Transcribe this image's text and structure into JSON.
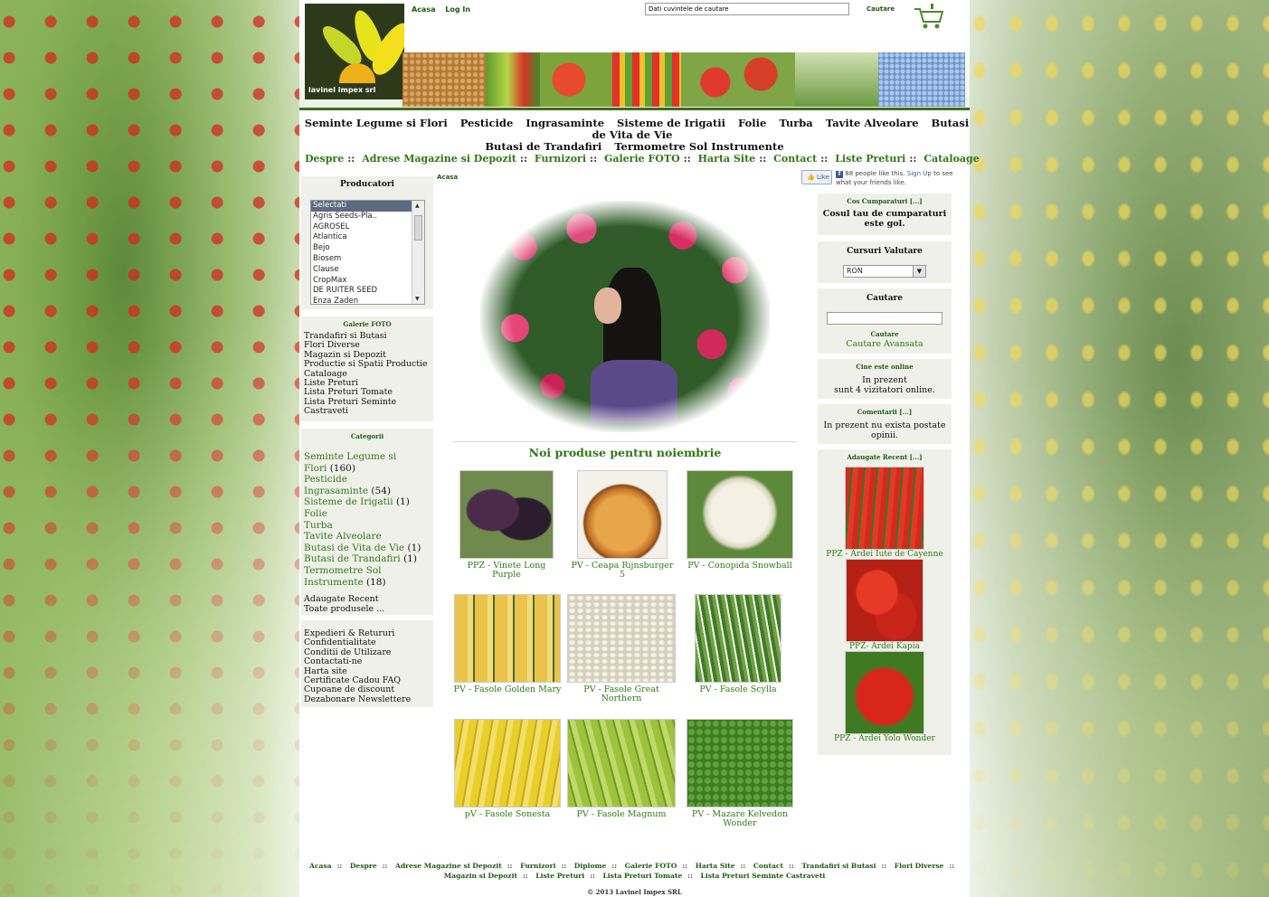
{
  "header": {
    "logo_text": "lavinel impex srl",
    "toplinks": [
      "Acasa",
      "Log In"
    ],
    "search_value": "Dati cuvintele de cautare",
    "search_button": "Cautare"
  },
  "nav_main": {
    "items": [
      "Seminte Legume si Flori",
      "Pesticide",
      "Ingrasaminte",
      "Sisteme de Irigatii",
      "Folie",
      "Turba",
      "Tavite Alveolare",
      "Butasi de Vita de Vie",
      "Butasi de Trandafiri",
      "Termometre Sol Instrumente"
    ]
  },
  "nav_secondary": {
    "items": [
      "Despre",
      "Adrese Magazine si Depozit",
      "Furnizori",
      "Galerie FOTO",
      "Harta Site",
      "Contact",
      "Liste Preturi",
      "Cataloage"
    ],
    "separator": "::"
  },
  "breadcrumb": "Acasa",
  "facebook": {
    "like_label": "Like",
    "text_prefix": "88 people like this.",
    "signup": "Sign Up",
    "text_suffix": "to see what your friends like."
  },
  "producatori": {
    "title": "Producatori",
    "options": [
      "Selectati",
      "Agris Seeds-Pla..",
      "AGROSEL",
      "Atlantica",
      "Bejo",
      "Biosem",
      "Clause",
      "CropMax",
      "DE RUITER SEED",
      "Enza Zaden"
    ]
  },
  "galerie": {
    "title": "Galerie FOTO",
    "items": [
      "Trandafiri si Butasi",
      "Flori Diverse",
      "Magazin si Depozit",
      "Productie si Spatii Productie",
      "Cataloage",
      "Liste Preturi",
      "Lista Preturi Tomate",
      "Lista Preturi Seminte",
      "Castraveti"
    ]
  },
  "categorii": {
    "title": "Categorii",
    "items": [
      {
        "name": "Seminte Legume si",
        "count": ""
      },
      {
        "name": "Flori",
        "count": "(160)"
      },
      {
        "name": "Pesticide",
        "count": ""
      },
      {
        "name": "Ingrasaminte",
        "count": "(54)"
      },
      {
        "name": "Sisteme de Irigatii",
        "count": "(1)"
      },
      {
        "name": "Folie",
        "count": ""
      },
      {
        "name": "Turba",
        "count": ""
      },
      {
        "name": "Tavite Alveolare",
        "count": ""
      },
      {
        "name": "Butasi de Vita de Vie",
        "count": "(1)"
      },
      {
        "name": "Butasi de Trandafiri",
        "count": "(1)"
      },
      {
        "name": "Termometre Sol",
        "count": ""
      },
      {
        "name": "Instrumente",
        "count": "(18)"
      }
    ],
    "recent": "Adaugate Recent",
    "all": "Toate produsele ..."
  },
  "info_links": [
    "Expedieri & Retururi",
    "Confidentialitate",
    "Conditii de Utilizare",
    "Contactati-ne",
    "Harta site",
    "Certificate Cadou FAQ",
    "Cupoane de discount",
    "Dezabonare Newslettere"
  ],
  "main": {
    "section_title": "Noi produse pentru noiembrie",
    "products": [
      {
        "label1": "PPZ - Vinete Long",
        "label2": "Purple"
      },
      {
        "label1": "PV - Ceapa Rijnsburger",
        "label2": "5"
      },
      {
        "label1": "PV - Conopida Snowball",
        "label2": ""
      },
      {
        "label1": "PV - Fasole Golden Mary",
        "label2": ""
      },
      {
        "label1": "PV - Fasole Great",
        "label2": "Northern"
      },
      {
        "label1": "PV - Fasole Scylla",
        "label2": ""
      },
      {
        "label1": "pV - Fasole Sonesta",
        "label2": ""
      },
      {
        "label1": "PV - Fasole Magnum",
        "label2": ""
      },
      {
        "label1": "PV - Mazare Kelvedon",
        "label2": "Wonder"
      }
    ]
  },
  "right": {
    "cart_title": "Cos Cumparaturi",
    "more": "[...]",
    "cart_empty1": "Cosul tau de cumparaturi",
    "cart_empty2": "este gol.",
    "currency_title": "Cursuri Valutare",
    "currency_value": "RON",
    "search_title": "Cautare",
    "search_button": "Cautare",
    "advanced": "Cautare Avansata",
    "online_title": "Cine este online",
    "online1": "In prezent",
    "online2": "sunt 4 vizitatori online.",
    "comments_title": "Comentarii",
    "comments1": "In prezent nu exista postate",
    "comments2": "opinii.",
    "recent_title": "Adaugate Recent",
    "recent": [
      "PPZ - Ardei Iute de Cayenne",
      "PPZ- Ardei Kapia",
      "PPZ - Ardei Yolo Wonder"
    ]
  },
  "footer": {
    "row1": [
      "Acasa",
      "Despre",
      "Adrese Magazine si Depozit",
      "Furnizori",
      "Diplome",
      "Galerie FOTO",
      "Harta Site",
      "Contact",
      "Trandafiri si Butasi",
      "Flori Diverse"
    ],
    "row2": [
      "Magazin si Depozit",
      "Liste Preturi",
      "Lista Preturi Tomate",
      "Lista Preturi Seminte Castraveti"
    ],
    "separator": "::",
    "copyright": "© 2013 Lavinel Impex SRL"
  }
}
